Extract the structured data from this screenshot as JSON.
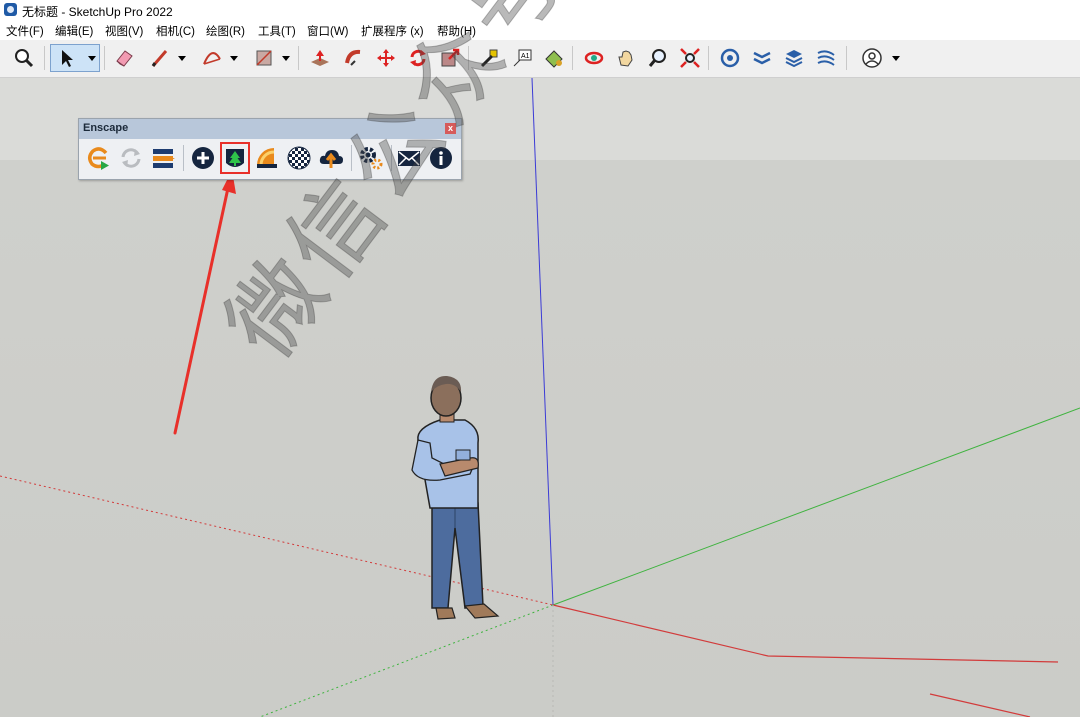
{
  "window": {
    "title": "无标题 - SketchUp Pro 2022",
    "icon": "sketchup-app-icon"
  },
  "menubar": {
    "items": [
      "文件(F)",
      "编辑(E)",
      "视图(V)",
      "相机(C)",
      "绘图(R)",
      "工具(T)",
      "窗口(W)",
      "扩展程序 (x)",
      "帮助(H)"
    ]
  },
  "toolbar": {
    "tools": [
      "zoom-icon",
      "select-arrow-icon",
      "eraser-icon",
      "pencil-line-icon",
      "arc-icon",
      "rectangle-icon",
      "push-pull-icon",
      "follow-me-icon",
      "move-icon",
      "rotate-icon",
      "scale-icon",
      "tape-measure-icon",
      "text-label-icon",
      "paint-bucket-icon",
      "orbit-icon",
      "pan-hand-icon",
      "zoom-magnifier-icon",
      "zoom-extents-icon",
      "warehouse-icon",
      "extension-warehouse-icon",
      "layers-icon",
      "sandbox-icon",
      "profile-icon"
    ],
    "active_tool": "select-arrow-icon"
  },
  "enscape_panel": {
    "title": "Enscape",
    "close_label": "x",
    "buttons": [
      "enscape-start-icon",
      "sync-refresh-icon",
      "capture-views-icon",
      "add-icon",
      "asset-library-tree-icon",
      "material-editor-icon",
      "visual-settings-icon",
      "upload-cloud-icon",
      "settings-gears-icon",
      "feedback-mail-icon",
      "about-info-icon"
    ],
    "highlighted_button": "asset-library-tree-icon"
  },
  "scene": {
    "annotation_color": "#e8302a",
    "axis_colors": {
      "blue": "#3b3bd6",
      "green": "#3fb33f",
      "red": "#d23b3b"
    }
  },
  "watermark": {
    "text": "微信公众号：安装软件指南"
  }
}
